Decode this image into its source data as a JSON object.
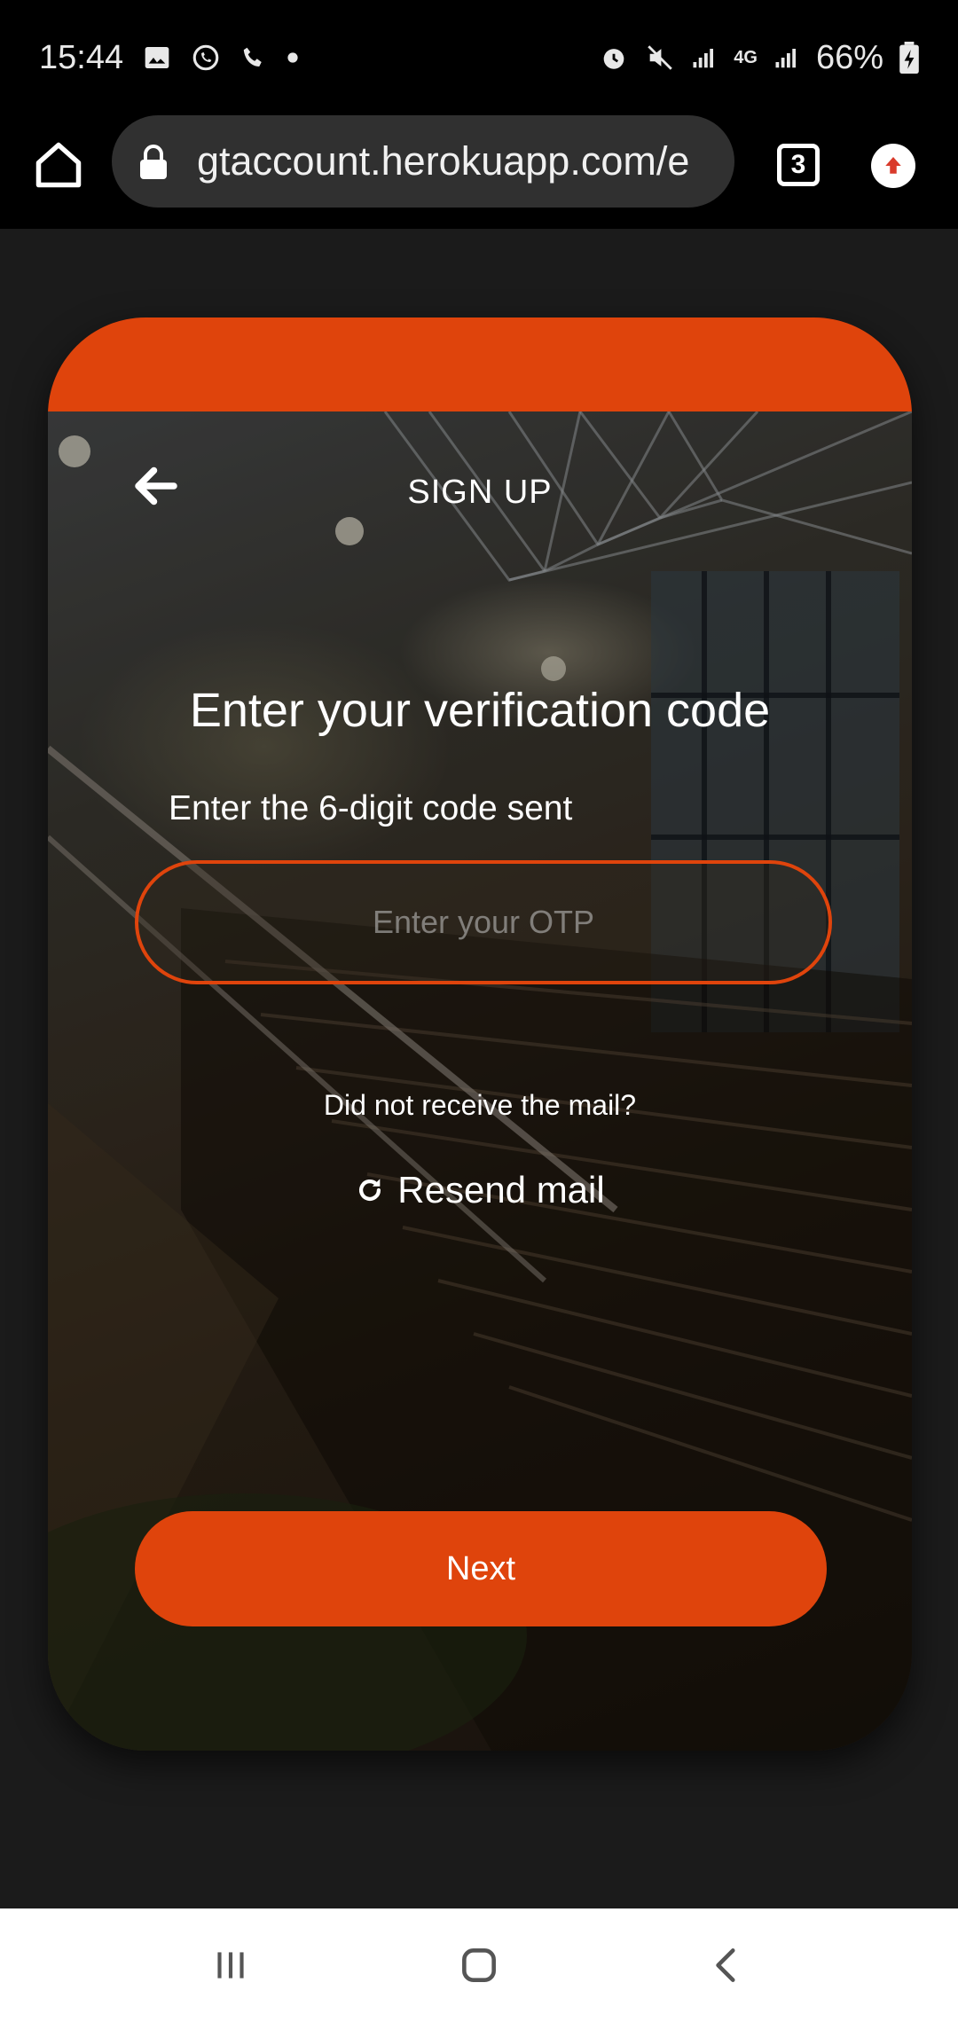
{
  "status_bar": {
    "time": "15:44",
    "battery": "66%",
    "network": "4G",
    "icons": [
      "image-icon",
      "whatsapp-icon",
      "phone-icon",
      "dot-icon",
      "alarm-icon",
      "mute-icon",
      "signal-icon",
      "data-4g-icon",
      "signal-icon",
      "battery-charging-icon"
    ]
  },
  "browser": {
    "url": "gtaccount.herokuapp.com/e",
    "tab_count": "3",
    "icons": [
      "home-icon",
      "lock-icon",
      "tabs-icon",
      "update-icon"
    ]
  },
  "card": {
    "title": "SIGN UP",
    "heading": "Enter your verification code",
    "subheading": "Enter the 6-digit code sent",
    "otp_placeholder": "Enter your OTP",
    "no_mail_text": "Did not receive the mail?",
    "resend_label": "Resend mail",
    "next_label": "Next",
    "accent_color": "#df440c"
  },
  "nav_bar": {
    "icons": [
      "recent-apps-icon",
      "home-button-icon",
      "back-icon"
    ]
  }
}
